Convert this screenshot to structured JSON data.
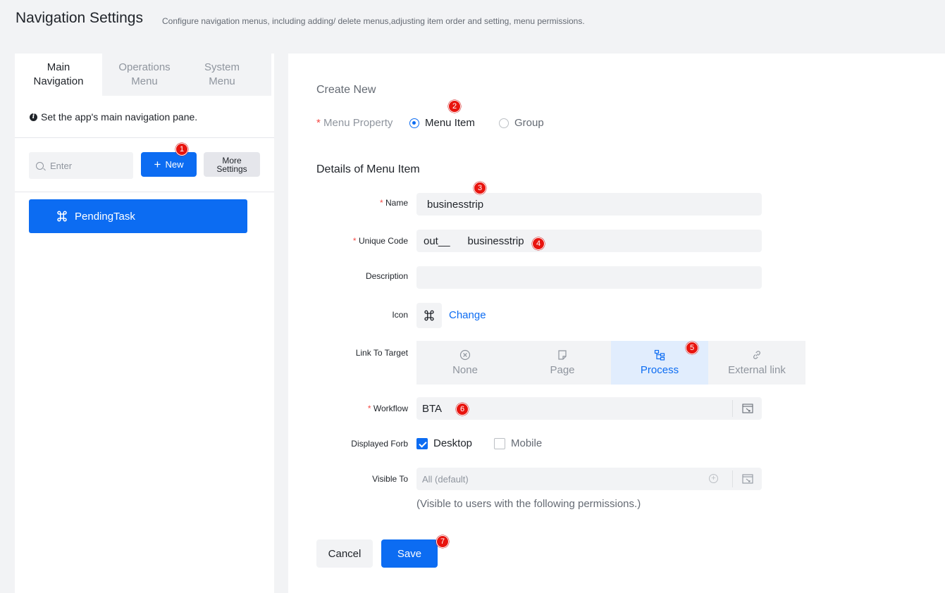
{
  "header": {
    "title": "Navigation Settings",
    "description": "Configure navigation menus, including adding/ delete menus,adjusting item order and setting, menu permissions."
  },
  "left": {
    "tabs": [
      {
        "label": "Main Navigation",
        "active": true
      },
      {
        "label": "Operations Menu",
        "active": false
      },
      {
        "label": "System Menu",
        "active": false
      }
    ],
    "hint": "Set the app's main navigation pane.",
    "search_placeholder": "Enter",
    "new_label": "New",
    "more_label": "More Settings",
    "nav_items": [
      {
        "label": "PendingTask",
        "icon": "command-icon",
        "selected": true
      }
    ]
  },
  "form": {
    "create_title": "Create New",
    "menu_property_label": "Menu Property",
    "menu_property_options": [
      {
        "label": "Menu Item",
        "selected": true
      },
      {
        "label": "Group",
        "selected": false
      }
    ],
    "details_title": "Details of Menu Item",
    "name_label": "Name",
    "name_value": "businesstrip",
    "code_label": "Unique Code",
    "code_prefix": "out__",
    "code_value": "businesstrip",
    "description_label": "Description",
    "description_value": "",
    "icon_label": "Icon",
    "icon_change": "Change",
    "link_label": "Link To Target",
    "link_targets": [
      {
        "label": "None",
        "icon": "close-circle-icon",
        "active": false
      },
      {
        "label": "Page",
        "icon": "page-icon",
        "active": false
      },
      {
        "label": "Process",
        "icon": "process-icon",
        "active": true
      },
      {
        "label": "External link",
        "icon": "link-icon",
        "active": false
      }
    ],
    "workflow_label": "Workflow",
    "workflow_value": "BTA",
    "displayed_label": "Displayed Forb",
    "displayed_options": [
      {
        "label": "Desktop",
        "checked": true
      },
      {
        "label": "Mobile",
        "checked": false
      }
    ],
    "visible_label": "Visible To",
    "visible_value": "All (default)",
    "visible_note": "(Visible to users with the following permissions.)",
    "cancel_label": "Cancel",
    "save_label": "Save"
  },
  "annotations": [
    "1",
    "2",
    "3",
    "4",
    "5",
    "6",
    "7"
  ],
  "colors": {
    "primary": "#0c6cf2",
    "badge": "#e8140e",
    "required": "#f54a45"
  }
}
